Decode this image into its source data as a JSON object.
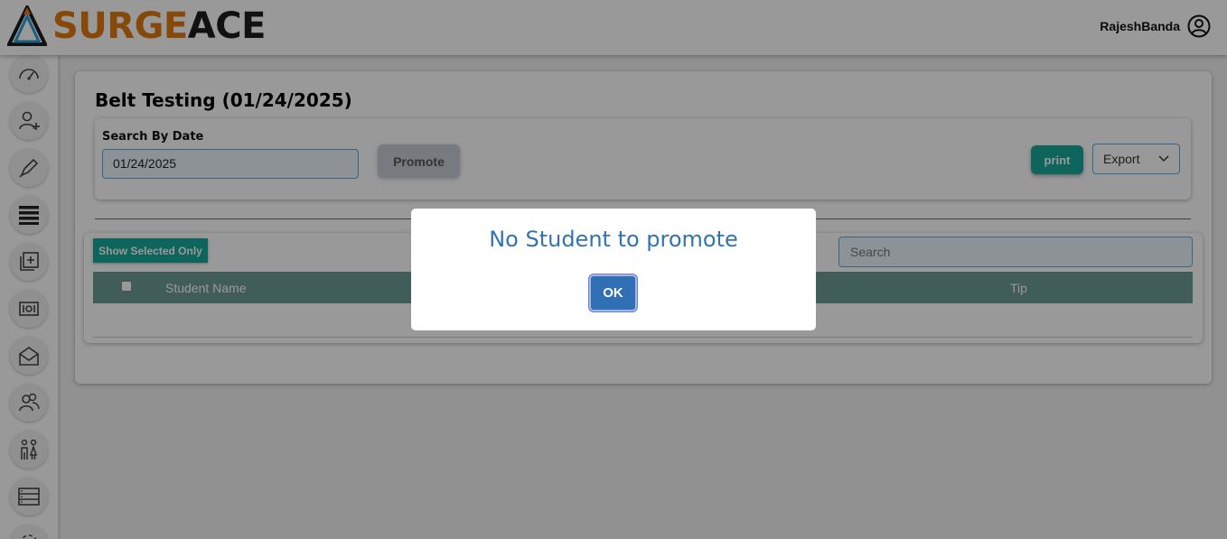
{
  "header": {
    "logo_part1": "SURGE",
    "logo_part2": "ACE",
    "user_name": "RajeshBanda",
    "user_icon": "user-circle-icon"
  },
  "sidebar": {
    "items": [
      {
        "icon": "dashboard-gauge-icon"
      },
      {
        "icon": "add-user-icon"
      },
      {
        "icon": "pen-icon"
      },
      {
        "icon": "list-rows-icon"
      },
      {
        "icon": "add-copy-icon"
      },
      {
        "icon": "money-bill-icon"
      },
      {
        "icon": "mail-open-icon"
      },
      {
        "icon": "users-group-icon"
      },
      {
        "icon": "parents-icon"
      },
      {
        "icon": "server-list-icon"
      },
      {
        "icon": "gear-icon"
      }
    ]
  },
  "main": {
    "title": "Belt Testing (01/24/2025)",
    "search_by_date_label": "Search By Date",
    "date_value": "01/24/2025",
    "promote_label": "Promote",
    "print_label": "print",
    "export_label": "Export",
    "show_selected_label": "Show Selected Only",
    "search_placeholder": "Search",
    "table": {
      "columns": [
        "Student Name",
        "Tip"
      ]
    }
  },
  "dialog": {
    "message": "No Student to promote",
    "ok_label": "OK"
  },
  "colors": {
    "accent_teal": "#16a89a",
    "table_header": "#6b9b97",
    "dialog_text": "#3474ae",
    "ok_button": "#2f6fb3",
    "logo_orange": "#e07b10"
  }
}
